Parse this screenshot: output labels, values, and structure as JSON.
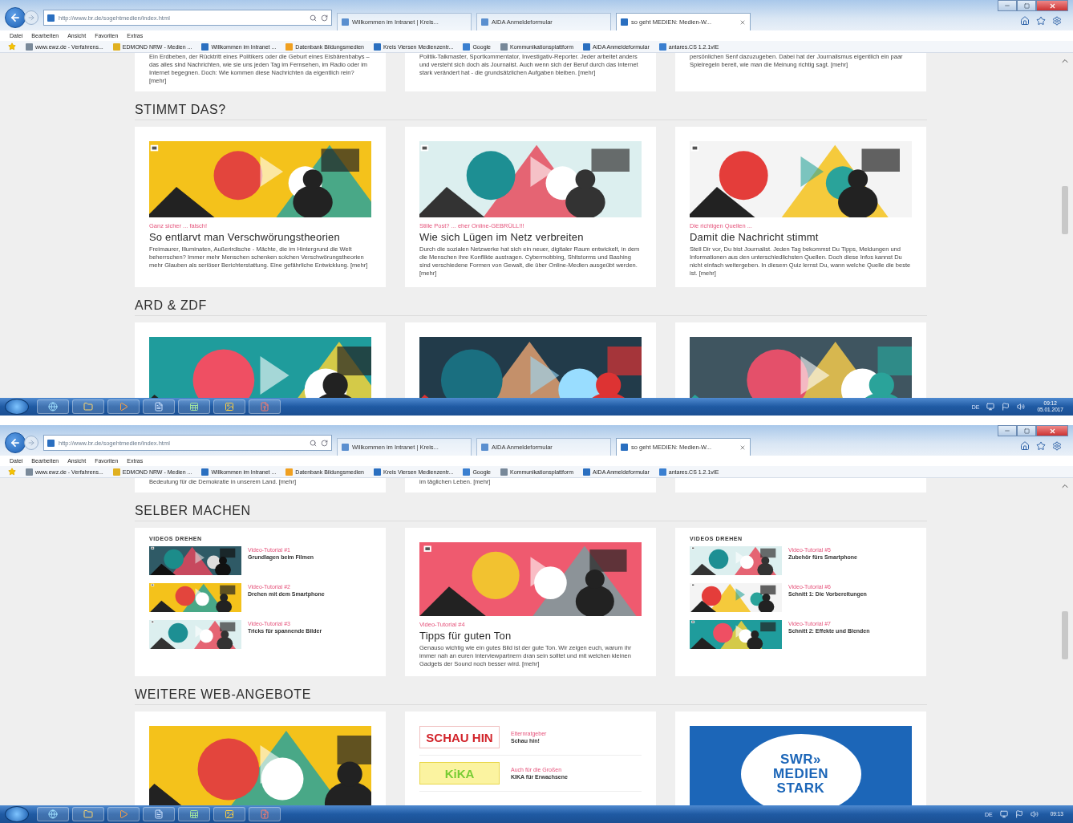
{
  "screens": [
    {
      "browser": {
        "url": "http://www.br.de/sogehtmedien/index.html",
        "tabs": [
          {
            "label": "Willkommen im Intranet | Kreis...",
            "selected": false
          },
          {
            "label": "AIDA Anmeldeformular",
            "selected": false
          },
          {
            "label": "so geht MEDIEN: Medien-W...",
            "selected": true
          }
        ],
        "menu": [
          "Datei",
          "Bearbeiten",
          "Ansicht",
          "Favoriten",
          "Extras"
        ],
        "favorites": [
          "www.ewz.de - Verfahrens...",
          "EDMOND NRW - Medien ...",
          "Willkommen im Intranet ...",
          "Datenbank Bildungsmedien",
          "Kreis Viersen Medienzentr...",
          "Google",
          "Kommunikationsplattform",
          "AIDA Anmeldeformular",
          "antares.CS 1.2.1vIE"
        ]
      },
      "sections": [
        {
          "columns": [
            {
              "kind": "text",
              "text": "Ein Erdbeben, der Rücktritt eines Politikers oder die Geburt eines Eisbärenbabys – das alles sind Nachrichten, wie sie uns jeden Tag im Fernsehen, im Radio oder im Internet begegnen. Doch: Wie kommen diese Nachrichten da eigentlich rein? [mehr]"
            },
            {
              "kind": "text",
              "text": "Politik-Talkmaster, Sportkommentator, Investigativ-Reporter. Jeder arbeitet anders und versteht sich doch als Journalist. Auch wenn sich der Beruf durch das Internet stark verändert hat - die grundsätzlichen Aufgaben bleiben. [mehr]"
            },
            {
              "kind": "text",
              "text": "persönlichen Senf dazuzugeben. Dabei hat der Journalismus eigentlich ein paar Spielregeln bereit, wie man die Meinung richtig sagt. [mehr]"
            }
          ]
        },
        {
          "heading": "STIMMT DAS?",
          "columns": [
            {
              "kind": "teaser",
              "kicker": "Ganz sicher ... falsch!",
              "title": "So entlarvt man Verschwörungstheorien",
              "text": "Freimaurer, Illuminaten, Außerirdische - Mächte, die im Hintergrund die Welt beherrschen? Immer mehr Menschen schenken solchen Verschwörungstheorien mehr Glauben als seriöser Berichterstattung. Eine gefährliche Entwicklung. [mehr]"
            },
            {
              "kind": "teaser",
              "kicker": "Stille Post? ... eher Online-GEBRÜLL!!!",
              "title": "Wie sich Lügen im Netz verbreiten",
              "text": "Durch die sozialen Netzwerke hat sich ein neuer, digitaler Raum entwickelt, in dem die Menschen ihre Konflikte austragen. Cybermobbing, Shitstorms und Bashing sind verschiedene Formen von Gewalt, die über Online-Medien ausgeübt werden. [mehr]"
            },
            {
              "kind": "teaser",
              "kicker": "Die richtigen Quellen ...",
              "title": "Damit die Nachricht stimmt",
              "text": "Stell Dir vor, Du bist Journalist. Jeden Tag bekommst Du Tipps, Meldungen und Informationen aus den unterschiedlichsten Quellen. Doch diese Infos kannst Du nicht einfach weitergeben. In diesem Quiz lernst Du, wann welche Quelle die beste ist. [mehr]"
            }
          ]
        },
        {
          "heading": "ARD & ZDF",
          "columns": [
            {
              "kind": "picture"
            },
            {
              "kind": "picture"
            },
            {
              "kind": "picture"
            }
          ]
        }
      ],
      "taskbar": {
        "language": "DE",
        "time": "09:12",
        "date": "05.01.2017"
      }
    },
    {
      "browser": {
        "url": "http://www.br.de/sogehtmedien/index.html",
        "tabs": [
          {
            "label": "Willkommen im Intranet | Kreis...",
            "selected": false
          },
          {
            "label": "AIDA Anmeldeformular",
            "selected": false
          },
          {
            "label": "so geht MEDIEN: Medien-W...",
            "selected": true
          }
        ],
        "menu": [
          "Datei",
          "Bearbeiten",
          "Ansicht",
          "Favoriten",
          "Extras"
        ],
        "favorites": [
          "www.ewz.de - Verfahrens...",
          "EDMOND NRW - Medien ...",
          "Willkommen im Intranet ...",
          "Datenbank Bildungsmedien",
          "Kreis Viersen Medienzentr...",
          "Google",
          "Kommunikationsplattform",
          "AIDA Anmeldeformular",
          "antares.CS 1.2.1vIE"
        ]
      },
      "sections": [
        {
          "columns": [
            {
              "kind": "text",
              "text": "Bedeutung für die Demokratie in unserem Land. [mehr]"
            },
            {
              "kind": "text",
              "text": "im täglichen Leben. [mehr]"
            },
            {
              "kind": "text"
            }
          ]
        },
        {
          "heading": "SELBER MACHEN",
          "columns": [
            {
              "kind": "list",
              "heading": "VIDEOS DREHEN",
              "items": [
                {
                  "kicker": "Video-Tutorial #1",
                  "title": "Grundlagen beim Filmen"
                },
                {
                  "kicker": "Video-Tutorial #2",
                  "title": "Drehen mit dem Smartphone"
                },
                {
                  "kicker": "Video-Tutorial #3",
                  "title": "Tricks für spannende Bilder"
                }
              ]
            },
            {
              "kind": "feature",
              "kicker": "Video-Tutorial #4",
              "title": "Tipps für guten Ton",
              "text": "Genauso wichtig wie ein gutes Bild ist der gute Ton. Wir zeigen euch, warum ihr immer nah an euren Interviewpartnern dran sein solltet und mit welchen kleinen Gadgets der Sound noch besser wird. [mehr]"
            },
            {
              "kind": "list",
              "heading": "VIDEOS DREHEN",
              "items": [
                {
                  "kicker": "Video-Tutorial #5",
                  "title": "Zubehör fürs Smartphone"
                },
                {
                  "kicker": "Video-Tutorial #6",
                  "title": "Schnitt 1: Die Vorbereitungen"
                },
                {
                  "kicker": "Video-Tutorial #7",
                  "title": "Schnitt 2: Effekte und Blenden"
                }
              ]
            }
          ]
        },
        {
          "heading": "WEITERE WEB-ANGEBOTE",
          "columns": [
            {
              "kind": "picture"
            },
            {
              "kind": "links",
              "items": [
                {
                  "logo": "SCHAU HIN",
                  "kicker": "Elternratgeber",
                  "title": "Schau hin!"
                },
                {
                  "logo": "KiKA",
                  "kicker": "Auch für die Großen",
                  "title": "KIKA für Erwachsene"
                }
              ]
            },
            {
              "kind": "logo",
              "lines": [
                "SWR»",
                "MEDIEN",
                "STARK"
              ]
            }
          ]
        }
      ],
      "taskbar": {
        "language": "DE",
        "time": "09:13"
      }
    }
  ]
}
